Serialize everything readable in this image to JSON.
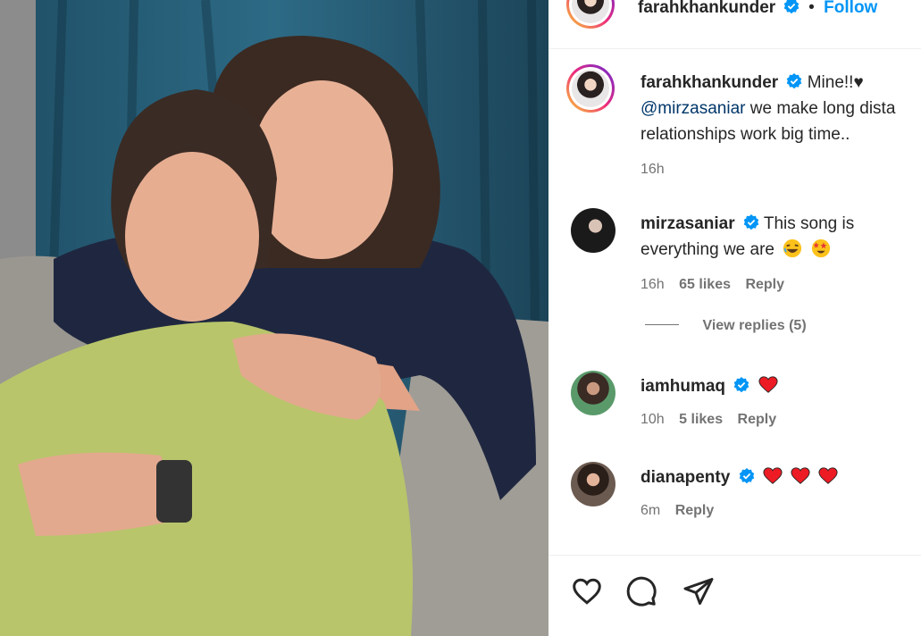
{
  "post": {
    "author": "farahkhankunder",
    "follow_label": "Follow",
    "separator": "•"
  },
  "caption": {
    "username": "farahkhankunder",
    "line1": "Mine!!♥",
    "mention": "@mirzasaniar",
    "line2": " we make long dista",
    "line3": "relationships work big time..",
    "time": "16h"
  },
  "comments": [
    {
      "username": "mirzasaniar",
      "text_line1": "This song is",
      "text_line2": "everything we are",
      "emojis": [
        "face-with-tears-of-joy",
        "star-struck"
      ],
      "time": "16h",
      "likes": "65 likes",
      "reply": "Reply",
      "view_replies": "View replies (5)"
    },
    {
      "username": "iamhumaq",
      "emojis": [
        "red-heart"
      ],
      "time": "10h",
      "likes": "5 likes",
      "reply": "Reply"
    },
    {
      "username": "dianapenty",
      "emojis": [
        "red-heart",
        "red-heart",
        "red-heart"
      ],
      "time": "6m",
      "reply": "Reply"
    }
  ],
  "actions": [
    "heart-icon",
    "comment-icon",
    "share-icon"
  ],
  "colors": {
    "link": "#0095f6",
    "mention": "#00376b",
    "verified": "#0095f6",
    "muted": "#737373",
    "heart": "#ed1c24"
  }
}
